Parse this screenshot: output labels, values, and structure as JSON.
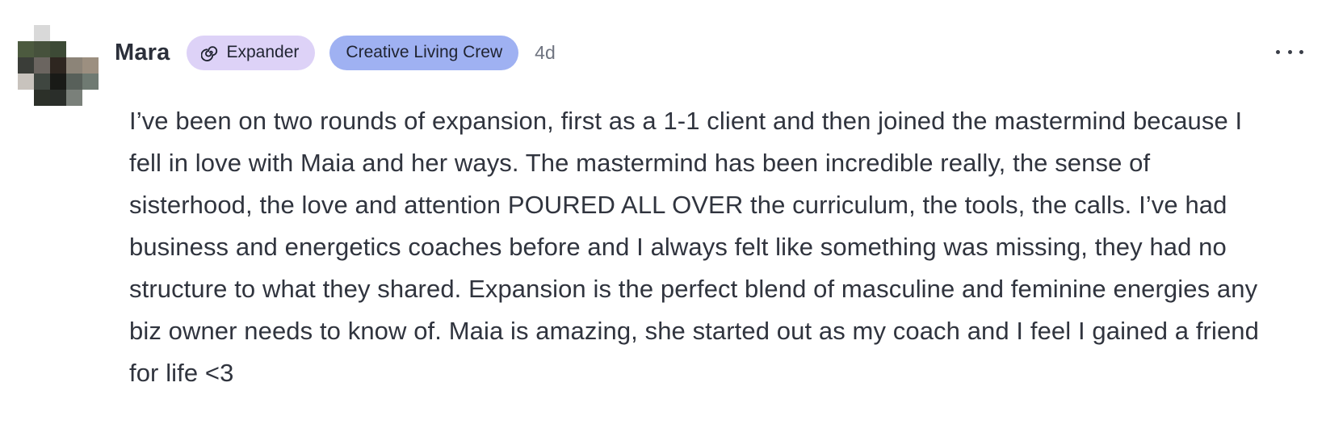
{
  "post": {
    "author": "Mara",
    "badges": {
      "expander_label": "Expander",
      "expander_icon": "spiral-icon",
      "crew_label": "Creative Living Crew"
    },
    "timestamp": "4d",
    "more_icon": "more-horizontal-icon",
    "body": "I’ve been on two rounds of expansion, first as a 1-1 client and then joined the mastermind because I fell in love with Maia and her ways. The mastermind has been incredible really, the sense of sisterhood, the love and attention POURED ALL OVER the curriculum, the tools, the calls. I’ve had business and energetics coaches before and I always felt like something was missing, they had no structure to what they shared. Expansion is the perfect blend of masculine and feminine energies any biz owner needs to know of. Maia is amazing, she started out as my coach and I feel I gained a friend for life <3"
  },
  "colors": {
    "expander_badge_bg": "#ddd2f7",
    "crew_badge_bg": "#9fb1f2",
    "text": "#30343e",
    "muted": "#6f7480"
  },
  "avatar": {
    "style": "pixelated",
    "pixels": [
      "#ffffff",
      "#d9d9d9",
      "#ffffff",
      "#ffffff",
      "#ffffff",
      "#4c5a3f",
      "#46513c",
      "#3d4a36",
      "#ffffff",
      "#ffffff",
      "#3a3d38",
      "#6b6560",
      "#2e2620",
      "#8c8478",
      "#9c8f80",
      "#c8c3bd",
      "#3f4640",
      "#191a17",
      "#58605a",
      "#6f7a72",
      "#ffffff",
      "#2c3029",
      "#2a2e2a",
      "#7a807a",
      "#ffffff"
    ]
  }
}
